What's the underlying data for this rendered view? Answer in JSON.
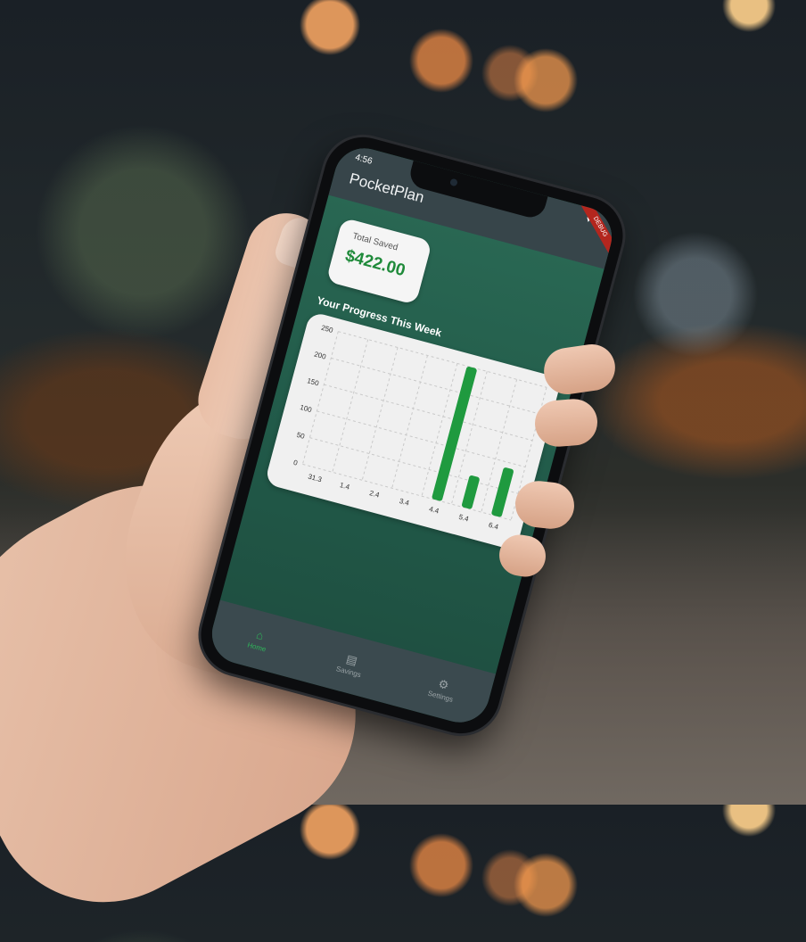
{
  "status_bar": {
    "time": "4:56",
    "icons": [
      "settings-icon",
      "clock-icon",
      "wifi-icon",
      "battery-icon"
    ]
  },
  "app": {
    "title": "PocketPlan",
    "debug_banner": "DEBUG"
  },
  "summary": {
    "label": "Total Saved",
    "value": "$422.00"
  },
  "progress": {
    "title": "Your Progress This Week"
  },
  "chart_data": {
    "type": "bar",
    "categories": [
      "31.3",
      "1.4",
      "2.4",
      "3.4",
      "4.4",
      "5.4",
      "6.4"
    ],
    "values": [
      0,
      0,
      0,
      0,
      250,
      60,
      90
    ],
    "ylim": [
      0,
      250
    ],
    "yticks": [
      "0",
      "50",
      "100",
      "150",
      "200",
      "250"
    ],
    "grid": true,
    "bar_color": "#1f9a3f"
  },
  "nav": {
    "items": [
      {
        "label": "Home",
        "icon": "home-icon",
        "glyph": "⌂",
        "active": true
      },
      {
        "label": "Savings",
        "icon": "savings-icon",
        "glyph": "▤",
        "active": false
      },
      {
        "label": "Settings",
        "icon": "gear-icon",
        "glyph": "⚙",
        "active": false
      }
    ]
  },
  "colors": {
    "accent": "#1f8a3a",
    "screen_bg": "#2b6a55",
    "app_bar": "#37454a",
    "nav_bg": "#3b4a4f"
  }
}
